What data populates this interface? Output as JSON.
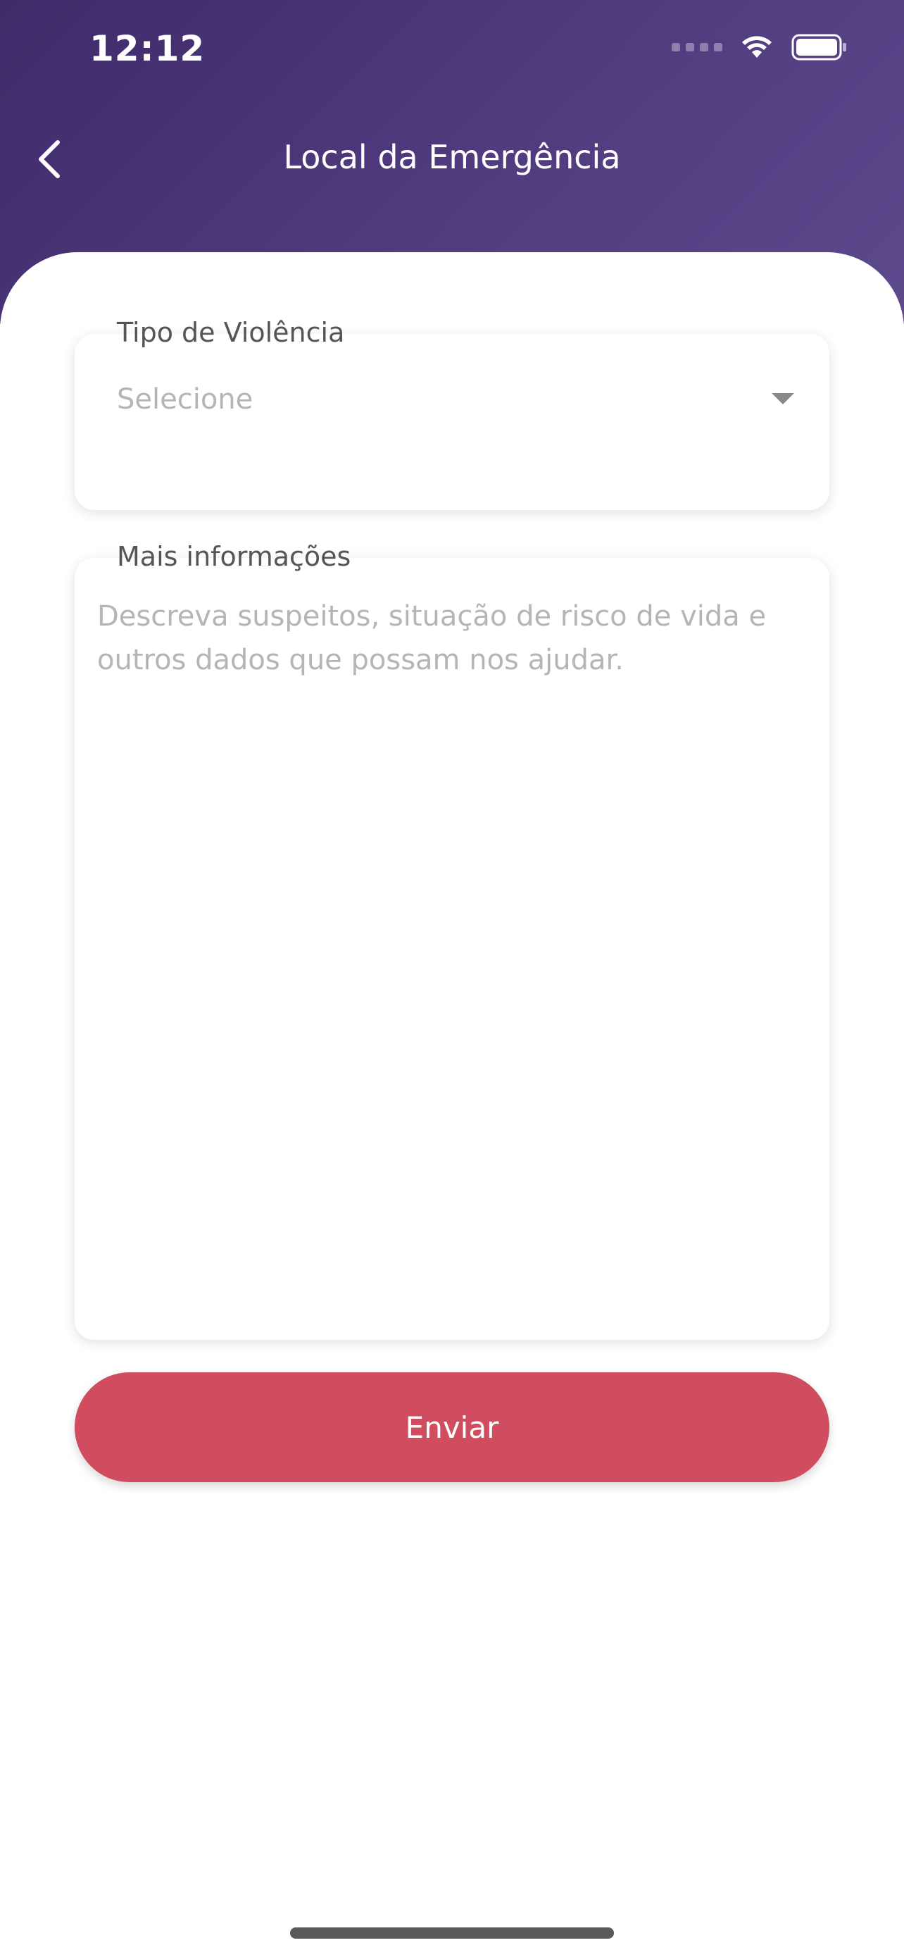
{
  "status_bar": {
    "time": "12:12"
  },
  "header": {
    "title": "Local da Emergência"
  },
  "form": {
    "violence_type": {
      "label": "Tipo de Violência",
      "placeholder": "Selecione"
    },
    "more_info": {
      "label": "Mais informações",
      "placeholder": "Descreva suspeitos, situação de risco de vida e outros dados que possam nos ajudar."
    },
    "submit_label": "Enviar"
  },
  "colors": {
    "header_gradient_start": "#3f2b6a",
    "header_gradient_end": "#5d4a8d",
    "button": "#cf4d5f"
  }
}
